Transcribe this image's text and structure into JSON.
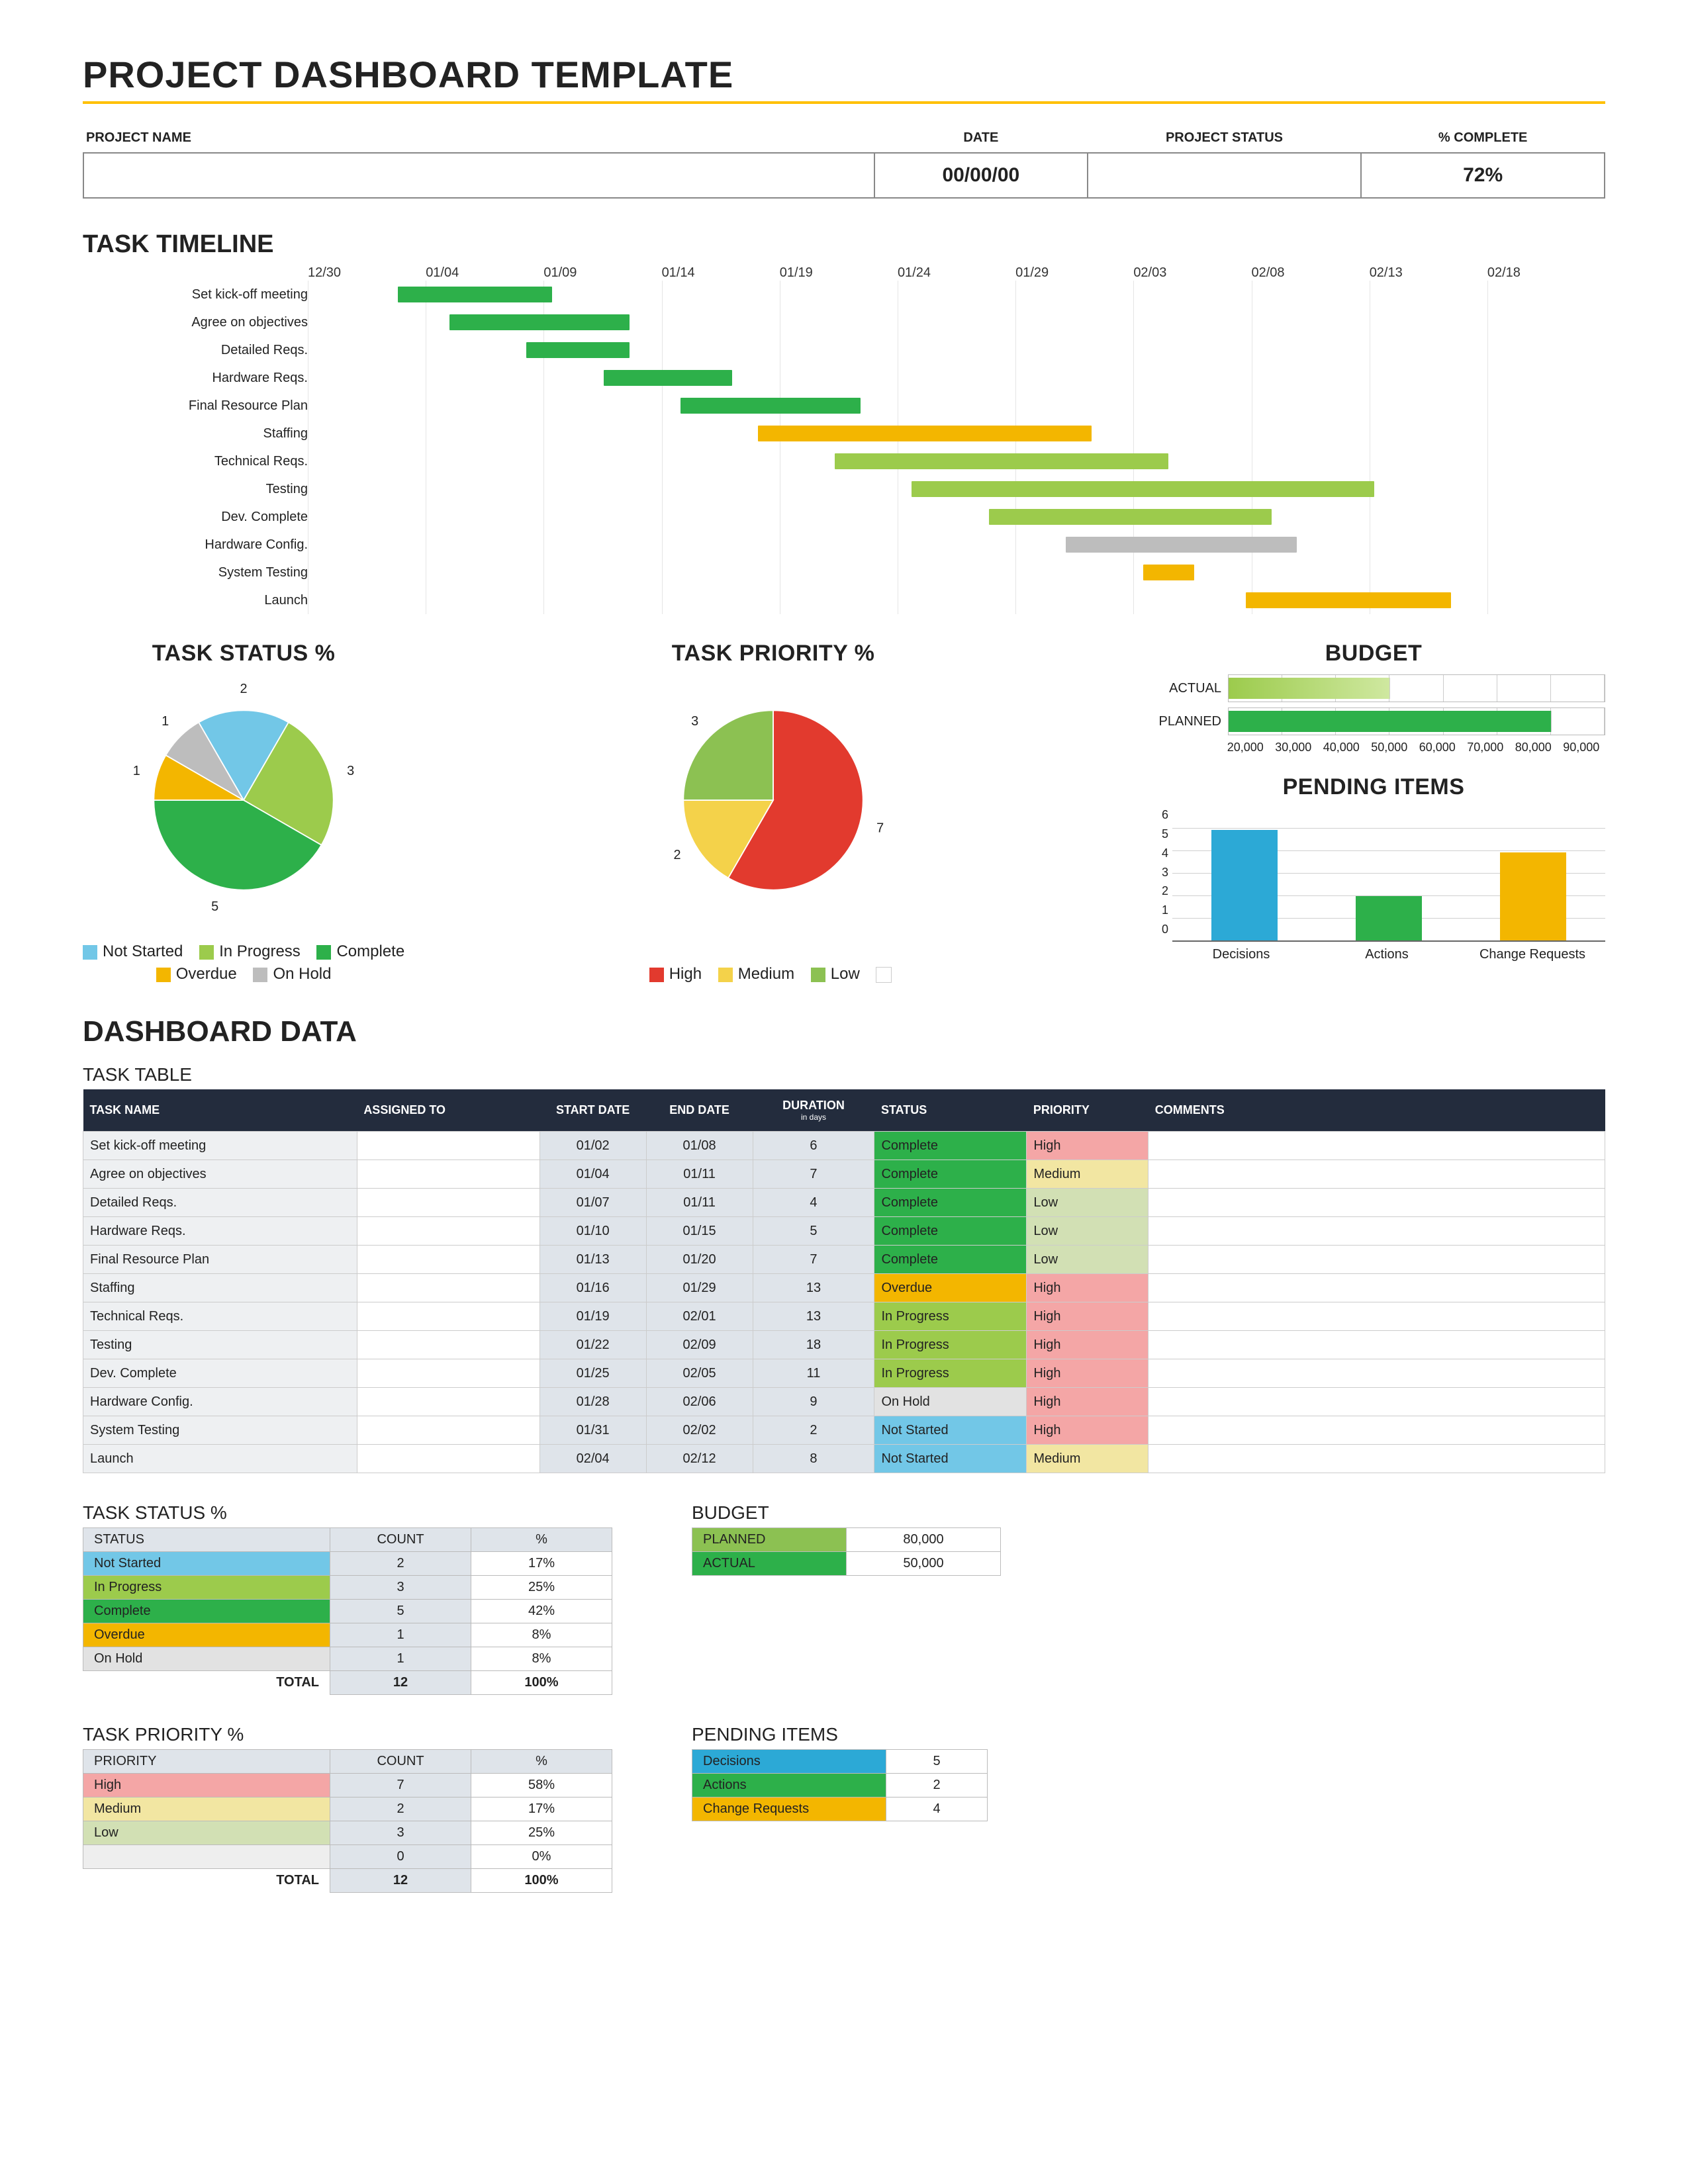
{
  "title": "PROJECT DASHBOARD TEMPLATE",
  "header": {
    "cols": [
      "PROJECT NAME",
      "DATE",
      "PROJECT STATUS",
      "% COMPLETE"
    ],
    "project_name": "",
    "date": "00/00/00",
    "status": "",
    "pct_complete": "72%"
  },
  "sections": {
    "timeline": "TASK TIMELINE",
    "task_status": "TASK STATUS %",
    "task_priority": "TASK PRIORITY %",
    "budget": "BUDGET",
    "pending": "PENDING ITEMS",
    "dashboard_data": "DASHBOARD DATA",
    "task_table": "TASK TABLE",
    "budget_tbl": "BUDGET",
    "pending_tbl": "PENDING ITEMS"
  },
  "legend": {
    "status": [
      "Not Started",
      "In Progress",
      "Complete",
      "Overdue",
      "On Hold"
    ],
    "priority": [
      "High",
      "Medium",
      "Low",
      ""
    ]
  },
  "task_table_headers": {
    "name": "TASK NAME",
    "assigned": "ASSIGNED TO",
    "start": "START DATE",
    "end": "END DATE",
    "duration": "DURATION",
    "duration_sub": "in days",
    "status": "STATUS",
    "priority": "PRIORITY",
    "comments": "COMMENTS"
  },
  "status_table_headers": {
    "status": "STATUS",
    "count": "COUNT",
    "pct": "%"
  },
  "priority_table_headers": {
    "priority": "PRIORITY",
    "count": "COUNT",
    "pct": "%"
  },
  "total_label": "TOTAL",
  "budget_labels": {
    "planned": "PLANNED",
    "actual": "ACTUAL"
  },
  "pending_labels": {
    "decisions": "Decisions",
    "actions": "Actions",
    "change": "Change Requests"
  },
  "chart_data": [
    {
      "type": "gantt",
      "title": "TASK TIMELINE",
      "date_axis": [
        "12/30",
        "01/04",
        "01/09",
        "01/14",
        "01/19",
        "01/24",
        "01/29",
        "02/03",
        "02/08",
        "02/13",
        "02/18"
      ],
      "x_range": [
        "12/30",
        "02/18"
      ],
      "tasks": [
        {
          "name": "Set kick-off meeting",
          "start": "01/02",
          "end": "01/08",
          "status": "Complete"
        },
        {
          "name": "Agree on objectives",
          "start": "01/04",
          "end": "01/11",
          "status": "Complete"
        },
        {
          "name": "Detailed Reqs.",
          "start": "01/07",
          "end": "01/11",
          "status": "Complete"
        },
        {
          "name": "Hardware Reqs.",
          "start": "01/10",
          "end": "01/15",
          "status": "Complete"
        },
        {
          "name": "Final Resource Plan",
          "start": "01/13",
          "end": "01/20",
          "status": "Complete"
        },
        {
          "name": "Staffing",
          "start": "01/16",
          "end": "01/29",
          "status": "Overdue"
        },
        {
          "name": "Technical Reqs.",
          "start": "01/19",
          "end": "02/01",
          "status": "In Progress"
        },
        {
          "name": "Testing",
          "start": "01/22",
          "end": "02/09",
          "status": "In Progress"
        },
        {
          "name": "Dev. Complete",
          "start": "01/25",
          "end": "02/05",
          "status": "In Progress"
        },
        {
          "name": "Hardware Config.",
          "start": "01/28",
          "end": "02/06",
          "status": "On Hold"
        },
        {
          "name": "System Testing",
          "start": "01/31",
          "end": "02/02",
          "status": "Overdue"
        },
        {
          "name": "Launch",
          "start": "02/04",
          "end": "02/12",
          "status": "Overdue"
        }
      ]
    },
    {
      "type": "pie",
      "title": "TASK STATUS %",
      "series": [
        {
          "name": "Not Started",
          "value": 2,
          "color": "#72c7e7"
        },
        {
          "name": "In Progress",
          "value": 3,
          "color": "#9ccb4c"
        },
        {
          "name": "Complete",
          "value": 5,
          "color": "#2db04a"
        },
        {
          "name": "Overdue",
          "value": 1,
          "color": "#f3b600"
        },
        {
          "name": "On Hold",
          "value": 1,
          "color": "#bdbdbd"
        }
      ],
      "total": 12
    },
    {
      "type": "pie",
      "title": "TASK PRIORITY %",
      "series": [
        {
          "name": "High",
          "value": 7,
          "color": "#e23a2e"
        },
        {
          "name": "Medium",
          "value": 2,
          "color": "#f4d24a"
        },
        {
          "name": "Low",
          "value": 3,
          "color": "#8cc152"
        },
        {
          "name": "",
          "value": 0,
          "color": "#ffffff"
        }
      ],
      "total": 12
    },
    {
      "type": "bar",
      "title": "BUDGET",
      "orientation": "horizontal",
      "categories": [
        "ACTUAL",
        "PLANNED"
      ],
      "values": [
        50000,
        80000
      ],
      "xlim": [
        20000,
        90000
      ],
      "xticks": [
        "20,000",
        "30,000",
        "40,000",
        "50,000",
        "60,000",
        "70,000",
        "80,000",
        "90,000"
      ]
    },
    {
      "type": "bar",
      "title": "PENDING ITEMS",
      "categories": [
        "Decisions",
        "Actions",
        "Change Requests"
      ],
      "values": [
        5,
        2,
        4
      ],
      "colors": [
        "#2ca9d6",
        "#2db04a",
        "#f3b600"
      ],
      "ylim": [
        0,
        6
      ],
      "yticks": [
        0,
        1,
        2,
        3,
        4,
        5,
        6
      ]
    }
  ],
  "tasks": [
    {
      "name": "Set kick-off meeting",
      "assigned": "",
      "start": "01/02",
      "end": "01/08",
      "duration": "6",
      "status": "Complete",
      "priority": "High",
      "comments": ""
    },
    {
      "name": "Agree on objectives",
      "assigned": "",
      "start": "01/04",
      "end": "01/11",
      "duration": "7",
      "status": "Complete",
      "priority": "Medium",
      "comments": ""
    },
    {
      "name": "Detailed Reqs.",
      "assigned": "",
      "start": "01/07",
      "end": "01/11",
      "duration": "4",
      "status": "Complete",
      "priority": "Low",
      "comments": ""
    },
    {
      "name": "Hardware Reqs.",
      "assigned": "",
      "start": "01/10",
      "end": "01/15",
      "duration": "5",
      "status": "Complete",
      "priority": "Low",
      "comments": ""
    },
    {
      "name": "Final Resource Plan",
      "assigned": "",
      "start": "01/13",
      "end": "01/20",
      "duration": "7",
      "status": "Complete",
      "priority": "Low",
      "comments": ""
    },
    {
      "name": "Staffing",
      "assigned": "",
      "start": "01/16",
      "end": "01/29",
      "duration": "13",
      "status": "Overdue",
      "priority": "High",
      "comments": ""
    },
    {
      "name": "Technical Reqs.",
      "assigned": "",
      "start": "01/19",
      "end": "02/01",
      "duration": "13",
      "status": "In Progress",
      "priority": "High",
      "comments": ""
    },
    {
      "name": "Testing",
      "assigned": "",
      "start": "01/22",
      "end": "02/09",
      "duration": "18",
      "status": "In Progress",
      "priority": "High",
      "comments": ""
    },
    {
      "name": "Dev. Complete",
      "assigned": "",
      "start": "01/25",
      "end": "02/05",
      "duration": "11",
      "status": "In Progress",
      "priority": "High",
      "comments": ""
    },
    {
      "name": "Hardware Config.",
      "assigned": "",
      "start": "01/28",
      "end": "02/06",
      "duration": "9",
      "status": "On Hold",
      "priority": "High",
      "comments": ""
    },
    {
      "name": "System Testing",
      "assigned": "",
      "start": "01/31",
      "end": "02/02",
      "duration": "2",
      "status": "Not Started",
      "priority": "High",
      "comments": ""
    },
    {
      "name": "Launch",
      "assigned": "",
      "start": "02/04",
      "end": "02/12",
      "duration": "8",
      "status": "Not Started",
      "priority": "Medium",
      "comments": ""
    }
  ],
  "status_summary": {
    "rows": [
      {
        "status": "Not Started",
        "count": 2,
        "pct": "17%",
        "color": "#72c7e7"
      },
      {
        "status": "In Progress",
        "count": 3,
        "pct": "25%",
        "color": "#9ccb4c"
      },
      {
        "status": "Complete",
        "count": 5,
        "pct": "42%",
        "color": "#2db04a"
      },
      {
        "status": "Overdue",
        "count": 1,
        "pct": "8%",
        "color": "#f3b600"
      },
      {
        "status": "On Hold",
        "count": 1,
        "pct": "8%",
        "color": "#e2e2e2"
      }
    ],
    "total_count": 12,
    "total_pct": "100%"
  },
  "priority_summary": {
    "rows": [
      {
        "priority": "High",
        "count": 7,
        "pct": "58%",
        "color": "#f4a6a6"
      },
      {
        "priority": "Medium",
        "count": 2,
        "pct": "17%",
        "color": "#f2e6a2"
      },
      {
        "priority": "Low",
        "count": 3,
        "pct": "25%",
        "color": "#d2e0b4"
      },
      {
        "priority": "",
        "count": 0,
        "pct": "0%",
        "color": "#eeeeee"
      }
    ],
    "total_count": 12,
    "total_pct": "100%"
  },
  "budget_table": {
    "planned": "80,000",
    "actual": "50,000"
  },
  "pending_table": [
    {
      "label": "Decisions",
      "value": 5,
      "color": "#2ca9d6"
    },
    {
      "label": "Actions",
      "value": 2,
      "color": "#2db04a"
    },
    {
      "label": "Change Requests",
      "value": 4,
      "color": "#f3b600"
    }
  ]
}
